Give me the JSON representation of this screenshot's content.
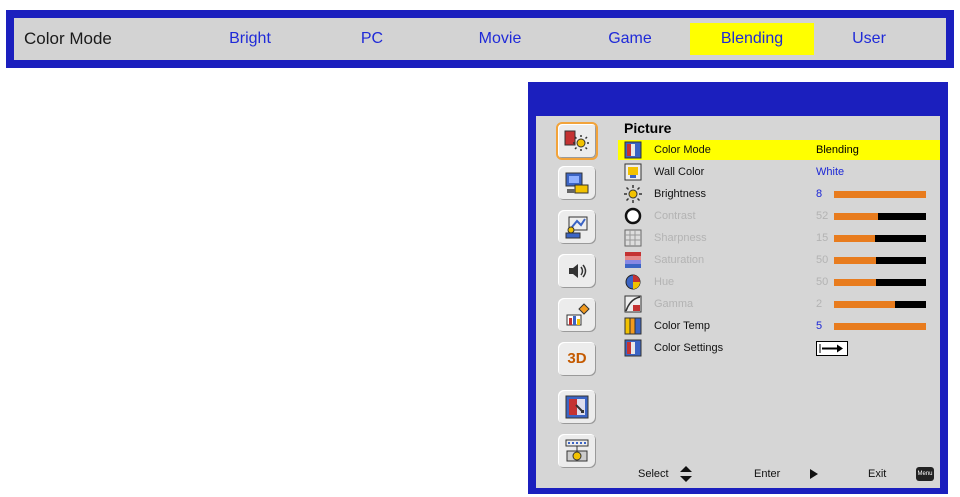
{
  "mode_bar": {
    "label": "Color Mode",
    "options": [
      {
        "label": "Bright",
        "selected": false
      },
      {
        "label": "PC",
        "selected": false
      },
      {
        "label": "Movie",
        "selected": false
      },
      {
        "label": "Game",
        "selected": false
      },
      {
        "label": "Blending",
        "selected": true
      },
      {
        "label": "User",
        "selected": false
      }
    ]
  },
  "osd": {
    "title": "Picture",
    "sidebar": [
      {
        "name": "picture-icon",
        "active": true
      },
      {
        "name": "display-icon",
        "active": false
      },
      {
        "name": "settings-icon",
        "active": false
      },
      {
        "name": "volume-icon",
        "active": false
      },
      {
        "name": "options-icon",
        "active": false
      },
      {
        "name": "3d-icon",
        "label": "3D",
        "active": false
      },
      {
        "name": "interactive-icon",
        "active": false
      },
      {
        "name": "lan-icon",
        "active": false
      }
    ],
    "rows": [
      {
        "label": "Color Mode",
        "value": "Blending",
        "type": "text",
        "enabled": true,
        "selected": true,
        "icon": "color-mode-icon"
      },
      {
        "label": "Wall Color",
        "value": "White",
        "type": "text",
        "enabled": true,
        "selected": false,
        "icon": "wall-color-icon"
      },
      {
        "label": "Brightness",
        "value": "8",
        "type": "bar",
        "level": 1.0,
        "enabled": true,
        "selected": false,
        "icon": "brightness-icon"
      },
      {
        "label": "Contrast",
        "value": "52",
        "type": "bar",
        "level": 0.48,
        "enabled": false,
        "selected": false,
        "icon": "contrast-icon"
      },
      {
        "label": "Sharpness",
        "value": "15",
        "type": "bar",
        "level": 0.45,
        "enabled": false,
        "selected": false,
        "icon": "sharpness-icon"
      },
      {
        "label": "Saturation",
        "value": "50",
        "type": "bar",
        "level": 0.46,
        "enabled": false,
        "selected": false,
        "icon": "saturation-icon"
      },
      {
        "label": "Hue",
        "value": "50",
        "type": "bar",
        "level": 0.46,
        "enabled": false,
        "selected": false,
        "icon": "hue-icon"
      },
      {
        "label": "Gamma",
        "value": "2",
        "type": "bar",
        "level": 0.66,
        "enabled": false,
        "selected": false,
        "icon": "gamma-icon"
      },
      {
        "label": "Color Temp",
        "value": "5",
        "type": "bar",
        "level": 1.0,
        "enabled": true,
        "selected": false,
        "icon": "color-temp-icon"
      },
      {
        "label": "Color Settings",
        "value": "",
        "type": "enter",
        "enabled": true,
        "selected": false,
        "icon": "color-settings-icon"
      }
    ],
    "footer": {
      "select_label": "Select",
      "enter_label": "Enter",
      "exit_label": "Exit",
      "menu_key": "Menu"
    },
    "colors": {
      "frame": "#1b1fbe",
      "highlight": "#ffff00",
      "bar_fill": "#e87c1e",
      "value_text": "#1c27d6"
    }
  }
}
